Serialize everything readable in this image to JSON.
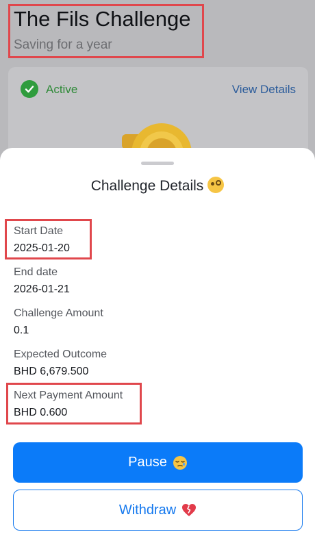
{
  "header": {
    "title": "The Fils Challenge",
    "subtitle": "Saving for a year"
  },
  "card": {
    "status": "Active",
    "view_details": "View Details"
  },
  "sheet": {
    "title": "Challenge Details",
    "fields": [
      {
        "label": "Start Date",
        "value": "2025-01-20"
      },
      {
        "label": "End date",
        "value": "2026-01-21"
      },
      {
        "label": "Challenge Amount",
        "value": "0.1"
      },
      {
        "label": "Expected Outcome",
        "value": "BHD 6,679.500"
      },
      {
        "label": "Next Payment Amount",
        "value": "BHD 0.600"
      }
    ]
  },
  "buttons": {
    "pause": "Pause",
    "withdraw": "Withdraw"
  },
  "colors": {
    "primary": "#0b7bf9",
    "success": "#2f9c3d",
    "highlight": "#e0474c"
  },
  "icons": [
    "check-icon",
    "coin-icon",
    "monocle-emoji-icon",
    "sleepy-emoji-icon",
    "broken-heart-icon"
  ]
}
